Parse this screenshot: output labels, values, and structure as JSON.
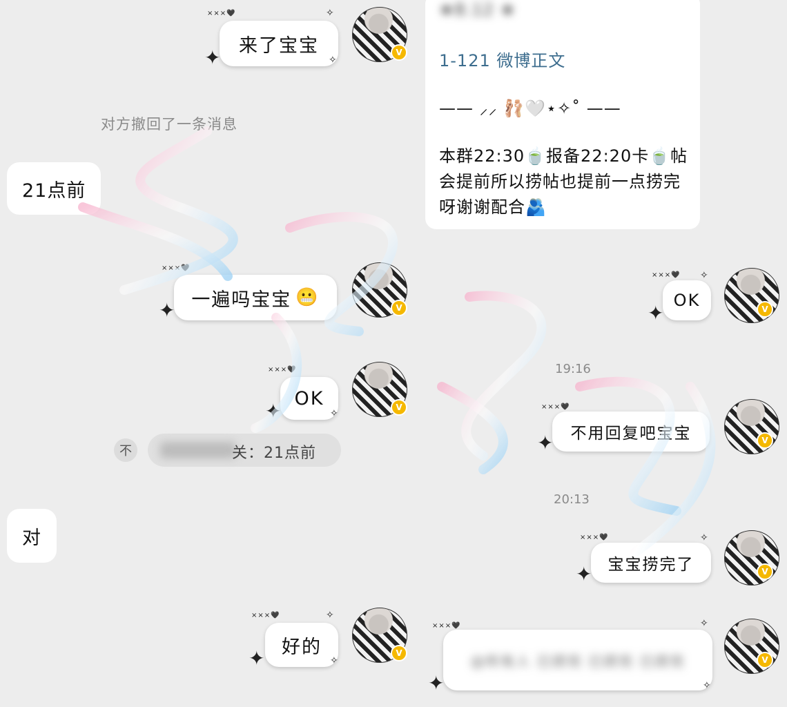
{
  "messages": {
    "m1": "来了宝宝",
    "recall": "对方撤回了一条消息",
    "m2": "21点前",
    "m3": "一遍吗宝宝",
    "m4": "OK",
    "quote_prefix": "不",
    "quote_text": "关：21点前",
    "m5": "对",
    "m6": "好的",
    "r1": "OK",
    "r2": "不用回复吧宝宝",
    "r3": "宝宝捞完了",
    "r4_blurred": "@所有人 已捞完 已捞完 已捞完"
  },
  "card": {
    "top_line": "★8.12 ★",
    "link": "1-121 微博正文",
    "divider": "—— ⸝⸝ 🩰🤍⋆✧˚ ——",
    "body": "本群22:30🍵报备22:20卡🍵帖会提前所以捞帖也提前一点捞完呀谢谢配合🫂"
  },
  "times": {
    "t1": "19:16",
    "t2": "20:13"
  },
  "tags": {
    "small_tag": "×××🖤"
  },
  "icons": {
    "sparkle": "sparkle-icon",
    "verified": "verified-badge-icon"
  },
  "colors": {
    "background": "#ededed",
    "bubble": "#ffffff",
    "link": "#3d6d8e",
    "badge": "#f5b800",
    "watermark_pink": "#f7b6cf",
    "watermark_blue": "#9fd2f4"
  }
}
